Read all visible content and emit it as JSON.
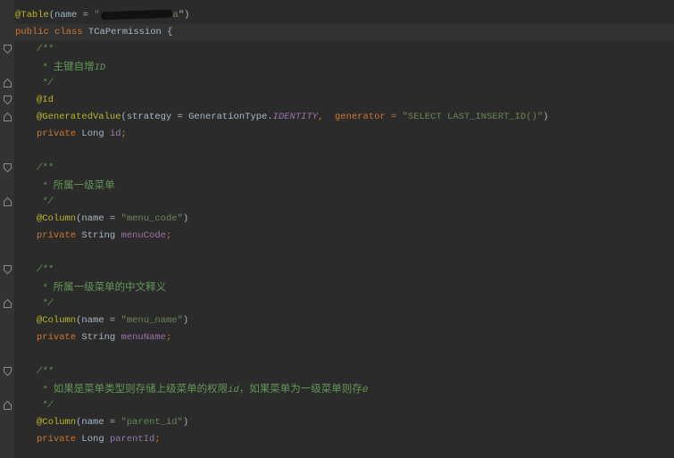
{
  "code": {
    "table_annotation": "@Table",
    "table_args_open": "(name = ",
    "table_name_open_quote": "\"",
    "table_name_visible_tail": "a",
    "table_name_close": "\")",
    "class_decl_kw": "public class ",
    "class_name": "TCaPermission",
    "class_brace": " {",
    "doc_open": "/**",
    "doc_close": "*/",
    "doc_star": "* ",
    "id_comment": "主键自增",
    "id_comment_suffix": "ID",
    "id_annotation": "@Id",
    "gen_annotation": "@GeneratedValue",
    "gen_args_1": "(strategy = GenerationType.",
    "gen_identity": "IDENTITY",
    "gen_args_2": ",  generator = ",
    "gen_string": "\"SELECT LAST_INSERT_ID()\"",
    "gen_close": ")",
    "private_kw": "private ",
    "type_long": "Long ",
    "type_string": "String ",
    "field_id": "id",
    "semicolon": ";",
    "menu_code_comment": "所属一级菜单",
    "column_annotation": "@Column",
    "column_args": "(name = ",
    "menu_code_col": "\"menu_code\"",
    "close_paren": ")",
    "field_menu_code": "menuCode",
    "menu_name_comment": "所属一级菜单的中文释义",
    "menu_name_col": "\"menu_name\"",
    "field_menu_name": "menuName",
    "parent_comment_1": "如果是菜单类型则存储上级菜单的权限",
    "parent_comment_id": "id",
    "parent_comment_2": "，如果菜单为一级菜单则存",
    "parent_comment_zero": "0",
    "parent_id_col": "\"parent_id\"",
    "field_parent_id": "parentId"
  },
  "colors": {
    "background": "#2b2b2b",
    "keyword": "#cc7832",
    "annotation": "#bbb529",
    "string": "#6a8759",
    "doc_comment": "#629755",
    "field": "#9876aa"
  },
  "icons": [
    "fold-open-icon",
    "fold-close-icon"
  ]
}
